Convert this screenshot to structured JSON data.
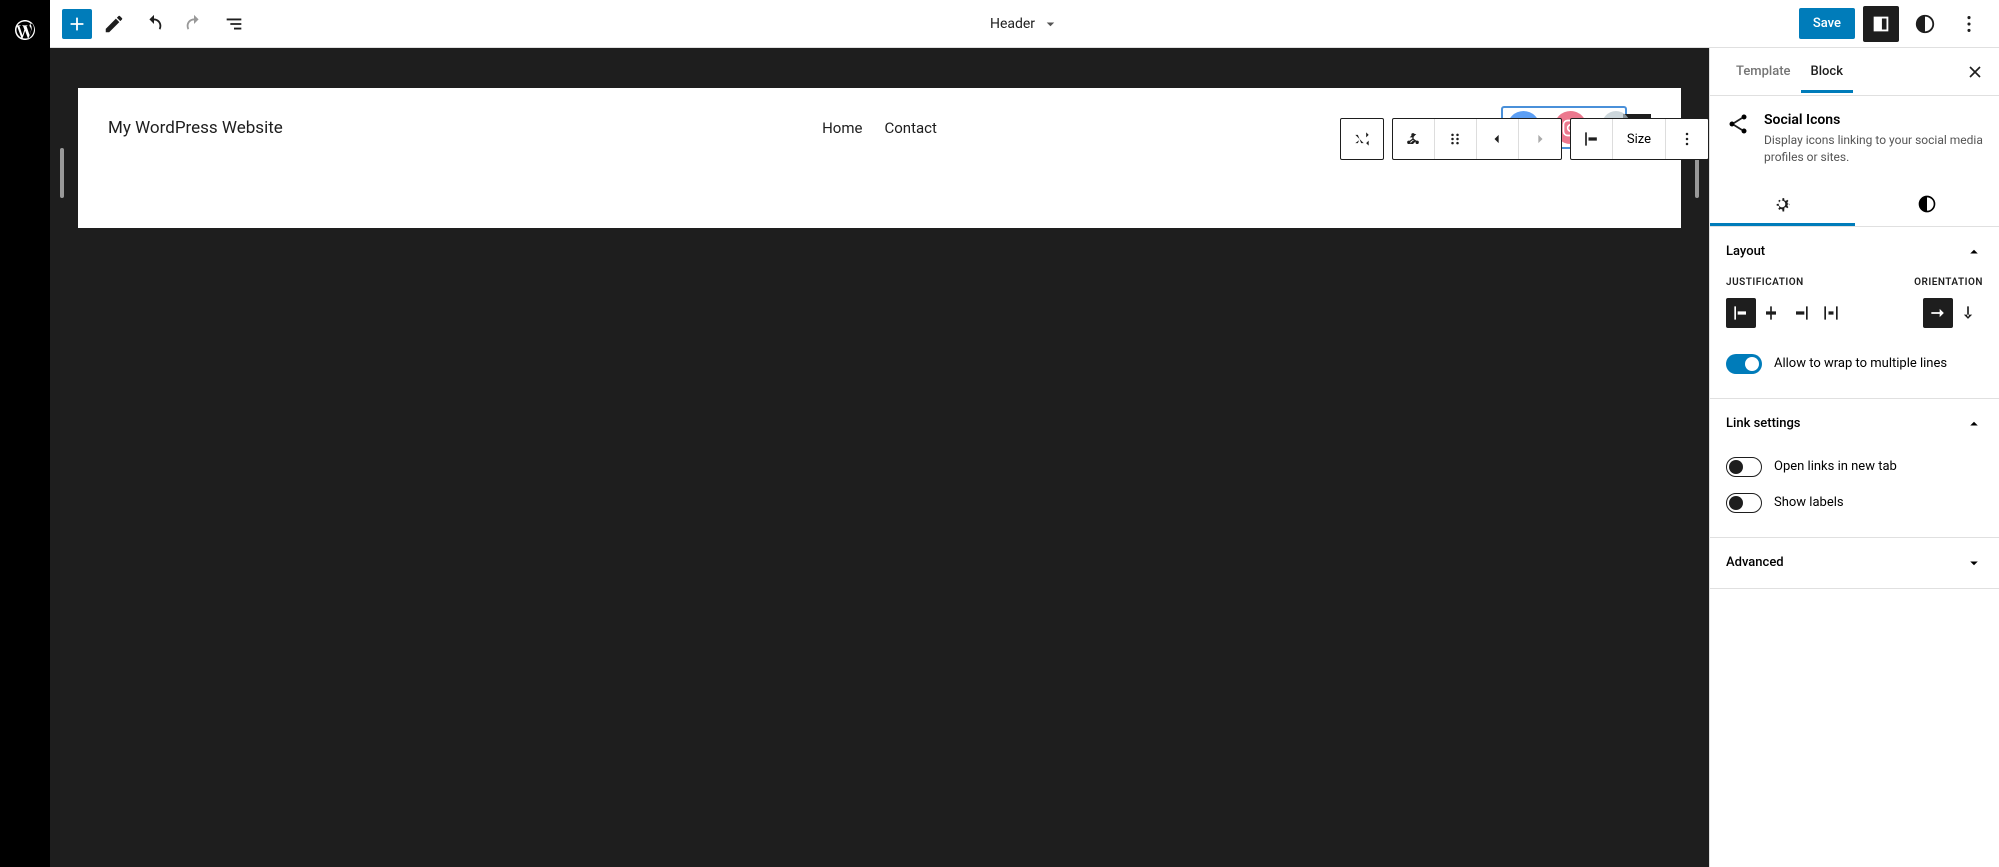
{
  "topbar": {
    "document_title": "Header",
    "save_label": "Save"
  },
  "canvas": {
    "site_title": "My WordPress Website",
    "nav": [
      "Home",
      "Contact"
    ],
    "social": [
      "facebook",
      "instagram"
    ],
    "toolbar": {
      "size_label": "Size"
    }
  },
  "sidebar": {
    "tabs": {
      "template": "Template",
      "block": "Block",
      "active": "block"
    },
    "block": {
      "title": "Social Icons",
      "description": "Display icons linking to your social media profiles or sites."
    },
    "layout": {
      "title": "Layout",
      "justification_label": "Justification",
      "orientation_label": "Orientation",
      "wrap_label": "Allow to wrap to multiple lines",
      "wrap_on": true,
      "justification": "left",
      "orientation": "horizontal"
    },
    "link_settings": {
      "title": "Link settings",
      "new_tab_label": "Open links in new tab",
      "new_tab_on": false,
      "show_labels_label": "Show labels",
      "show_labels_on": false
    },
    "advanced": {
      "title": "Advanced"
    }
  }
}
